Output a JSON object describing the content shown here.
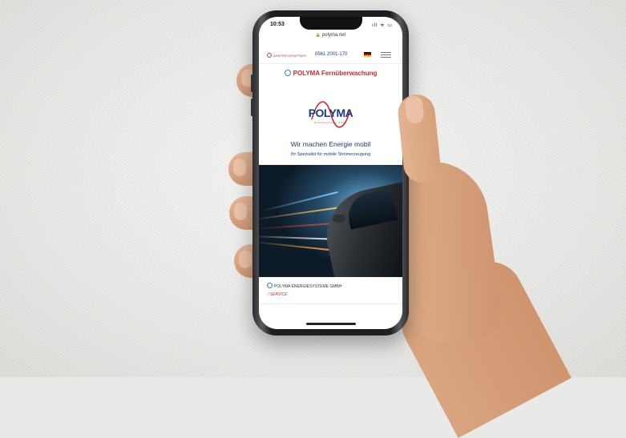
{
  "statusbar": {
    "time": "10:53",
    "system_icons": "ıll ᯤ ▭"
  },
  "browser": {
    "url": "polyma.net"
  },
  "topnav": {
    "contact_label": "ANSPRECHPARTNER",
    "phone": "0561 2001-170",
    "flag_name": "german-flag-icon",
    "menu_icon": "hamburger-menu-icon"
  },
  "fernueberwachung": {
    "label": "POLYMA Fernüberwachung",
    "icon": "globe-icon"
  },
  "logo": {
    "text": "POLYMA",
    "subtitle": "Energiesysteme GmbH",
    "brand_color": "#1b3a88",
    "accent_color": "#d02a2a"
  },
  "hero": {
    "slogan": "Wir machen Energie mobil",
    "subslogan": "Ihr Spezialist für mobile Stromerzeugung"
  },
  "footer": {
    "company": "POLYMA ENERGIESYSTEME GMBH",
    "service_link": "/ SERVICE"
  }
}
